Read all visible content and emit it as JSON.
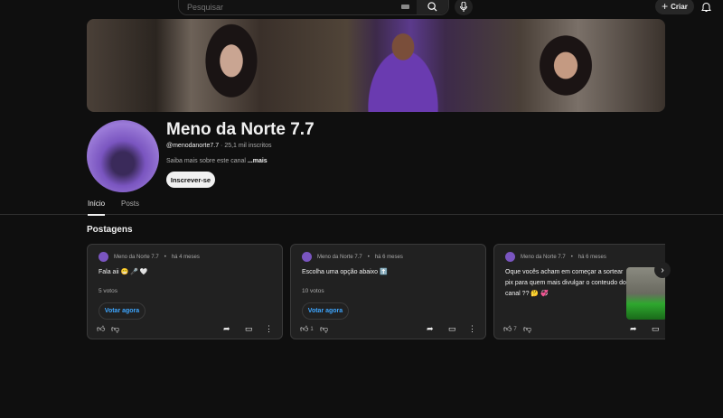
{
  "header": {
    "search_placeholder": "Pesquisar",
    "create_label": "Criar"
  },
  "channel": {
    "name": "Meno da Norte 7.7",
    "handle": "@menodanorte7.7",
    "subscribers": "25,1 mil inscritos",
    "about": "Saiba mais sobre este canal",
    "more": "...mais",
    "subscribe": "Inscrever-se"
  },
  "tabs": [
    {
      "label": "Início",
      "active": true
    },
    {
      "label": "Posts",
      "active": false
    }
  ],
  "section_title": "Postagens",
  "posts": [
    {
      "author": "Meno da Norte 7.7",
      "time": "há 4 meses",
      "text": "Fala aii 😁 🎤 🤍",
      "votes": "5 votos",
      "vote_label": "Votar agora",
      "likes": ""
    },
    {
      "author": "Meno da Norte 7.7",
      "time": "há 6 meses",
      "text": "Escolha uma opção abaixo ⬆️",
      "votes": "10 votos",
      "vote_label": "Votar agora",
      "likes": "1"
    },
    {
      "author": "Meno da Norte 7.7",
      "time": "há 6 meses",
      "text": "Oque vocês acham em começar a sortear pix para quem mais divulgar o conteudo do canal ?? 🤔 💞",
      "likes": "7"
    }
  ],
  "colors": {
    "accent": "#3ea6ff",
    "background": "#0f0f0f",
    "card": "#212121"
  }
}
